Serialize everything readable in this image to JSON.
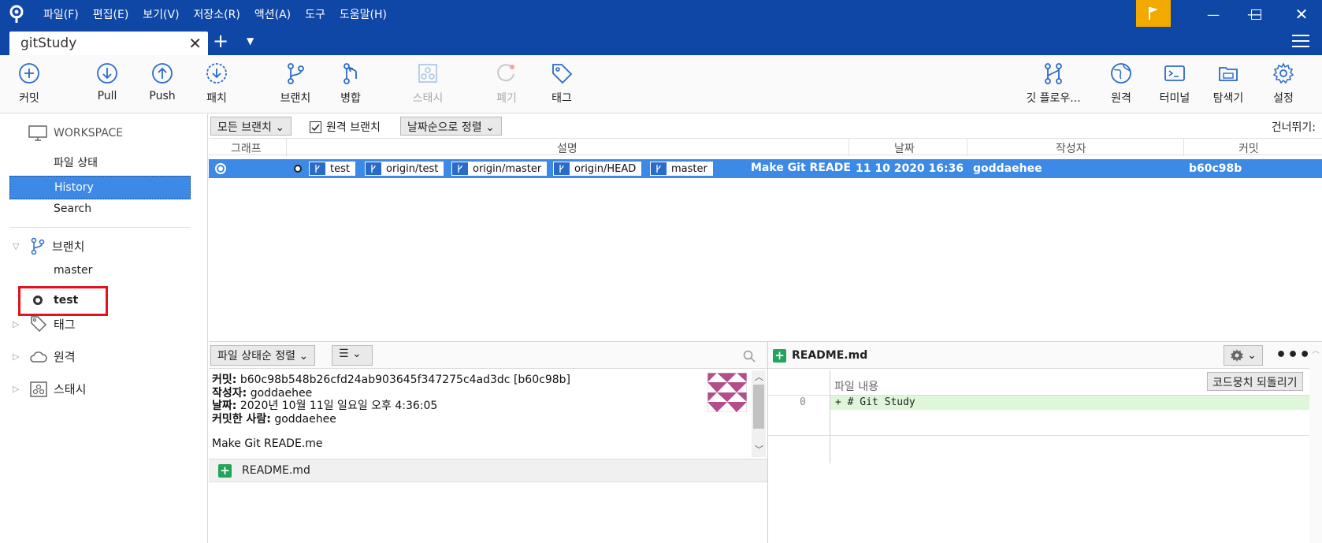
{
  "menu": [
    "파일(F)",
    "편집(E)",
    "보기(V)",
    "저장소(R)",
    "액션(A)",
    "도구",
    "도움말(H)"
  ],
  "tab": {
    "title": "gitStudy"
  },
  "toolbar": {
    "commit": "커밋",
    "pull": "Pull",
    "push": "Push",
    "patch": "패치",
    "branch": "브랜치",
    "merge": "병합",
    "stash": "스태시",
    "discard": "폐기",
    "tag": "태그",
    "gitflow": "깃 플로우...",
    "remote": "원격",
    "terminal": "터미널",
    "explorer": "탐색기",
    "settings": "설정"
  },
  "sidebar": {
    "workspace": "WORKSPACE",
    "file_status": "파일 상태",
    "history": "History",
    "search": "Search",
    "branches": "브랜치",
    "branch_master": "master",
    "branch_test": "test",
    "tags": "태그",
    "remotes": "원격",
    "stashes": "스태시"
  },
  "filter": {
    "all_branches": "모든 브랜치",
    "remote_branches": "원격 브랜치",
    "remote_checked": true,
    "sort": "날짜순으로 정렬",
    "skip": "건너뛰기:"
  },
  "columns": {
    "graph": "그래프",
    "desc": "설명",
    "date": "날짜",
    "author": "작성자",
    "commit": "커밋"
  },
  "commit_row": {
    "refs": [
      "test",
      "origin/test",
      "origin/master",
      "origin/HEAD",
      "master"
    ],
    "message": "Make Git READE",
    "date": "11 10 2020 16:36",
    "author": "goddaehee",
    "hash": "b60c98b"
  },
  "details": {
    "sort": "파일 상태순 정렬",
    "commit_label": "커밋:",
    "commit_value": "b60c98b548b26cfd24ab903645f347275c4ad3dc [b60c98b]",
    "author_label": "작성자:",
    "author_value": "goddaehee",
    "date_label": "날짜:",
    "date_value": "2020년 10월 11일 일요일 오후 4:36:05",
    "committer_label": "커밋한 사람:",
    "committer_value": "goddaehee",
    "message": "Make Git READE.me",
    "file": "README.md"
  },
  "diff": {
    "file": "README.md",
    "content_label": "파일 내용",
    "revert": "코드뭉치 되돌리기",
    "line_no": "0",
    "line": "+ # Git Study"
  },
  "colors": {
    "accent": "#0f47a6",
    "selection": "#3c8ae6",
    "flag": "#f2a900",
    "highlight_box": "#e0141d",
    "added": "#23a45c"
  }
}
